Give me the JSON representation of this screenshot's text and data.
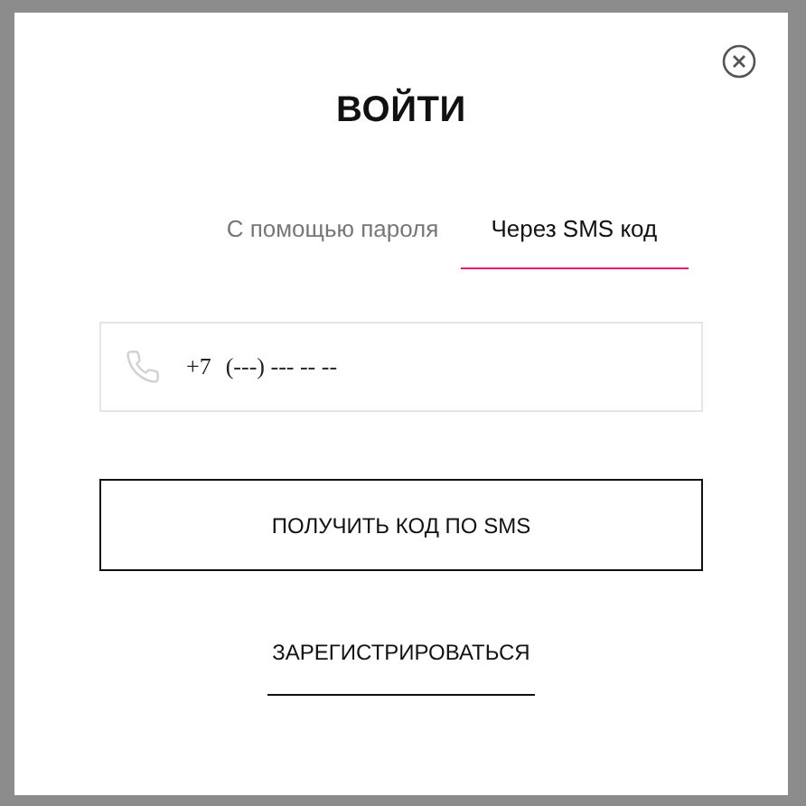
{
  "dialog": {
    "title": "ВОЙТИ"
  },
  "tabs": [
    {
      "label": "С помощью пароля",
      "selected": false
    },
    {
      "label": "Через SMS код",
      "selected": true
    }
  ],
  "phone_field": {
    "prefix": "+7",
    "placeholder": "(---) --- -- --"
  },
  "submit_button": "ПОЛУЧИТЬ КОД ПО SMS",
  "register_link": "ЗАРЕГИСТРИРОВАТЬСЯ"
}
